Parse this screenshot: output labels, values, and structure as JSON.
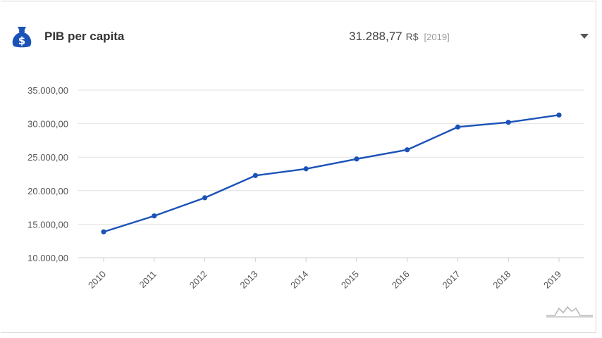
{
  "header": {
    "title": "PIB per capita",
    "value": "31.288,77",
    "unit": "R$",
    "year": "[2019]",
    "icon": "money-bag-icon",
    "accent": "#1a52b8"
  },
  "chart_data": {
    "type": "line",
    "title": "",
    "xlabel": "",
    "ylabel": "",
    "categories": [
      "2010",
      "2011",
      "2012",
      "2013",
      "2014",
      "2015",
      "2016",
      "2017",
      "2018",
      "2019"
    ],
    "series": [
      {
        "values": [
          13860,
          16240,
          18940,
          22260,
          23260,
          24730,
          26100,
          29500,
          30200,
          31288.77
        ]
      }
    ],
    "ylim": [
      10000,
      35000
    ],
    "yticks": [
      10000,
      15000,
      20000,
      25000,
      30000,
      35000
    ],
    "ytick_labels": [
      "10.000,00",
      "15.000,00",
      "20.000,00",
      "25.000,00",
      "30.000,00",
      "35.000,00"
    ],
    "grid": true,
    "color": "#1a52b8"
  }
}
